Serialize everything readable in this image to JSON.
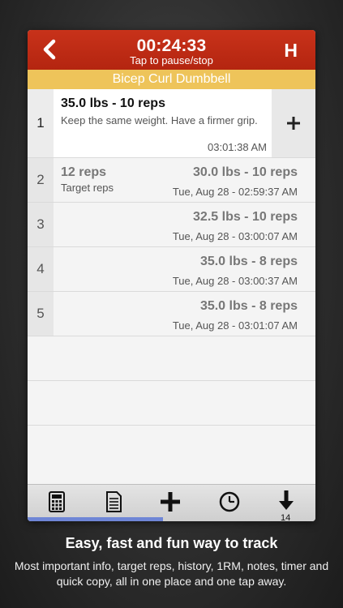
{
  "header": {
    "timer": "00:24:33",
    "timer_hint": "Tap to pause/stop",
    "right_button": "H",
    "bar_color": "#b42510"
  },
  "exercise": {
    "name": "Bicep Curl Dumbbell",
    "bar_color": "#eec45a"
  },
  "current_set": {
    "number": "1",
    "title": "35.0 lbs - 10 reps",
    "note": "Keep the same weight. Have a firmer grip.",
    "time": "03:01:38 AM",
    "add_icon": "plus-icon"
  },
  "sets": [
    {
      "number": "2",
      "target_reps": "12 reps",
      "target_label": "Target reps",
      "value": "30.0 lbs - 10 reps",
      "time": "Tue, Aug 28 - 02:59:37 AM"
    },
    {
      "number": "3",
      "target_reps": "",
      "target_label": "",
      "value": "32.5 lbs - 10 reps",
      "time": "Tue, Aug 28 - 03:00:07 AM"
    },
    {
      "number": "4",
      "target_reps": "",
      "target_label": "",
      "value": "35.0 lbs - 8 reps",
      "time": "Tue, Aug 28 - 03:00:37 AM"
    },
    {
      "number": "5",
      "target_reps": "",
      "target_label": "",
      "value": "35.0 lbs - 8 reps",
      "time": "Tue, Aug 28 - 03:01:07 AM"
    }
  ],
  "toolbar": {
    "icons": [
      "calculator-icon",
      "notes-icon",
      "plus-icon",
      "clock-icon",
      "download-icon"
    ],
    "download_count": "14",
    "progress": 0.47,
    "progress_color": "#6f86d6"
  },
  "caption": {
    "title": "Easy, fast and fun way to track",
    "description": "Most important info, target reps, history, 1RM, notes, timer and quick copy, all in one place and one tap away."
  }
}
